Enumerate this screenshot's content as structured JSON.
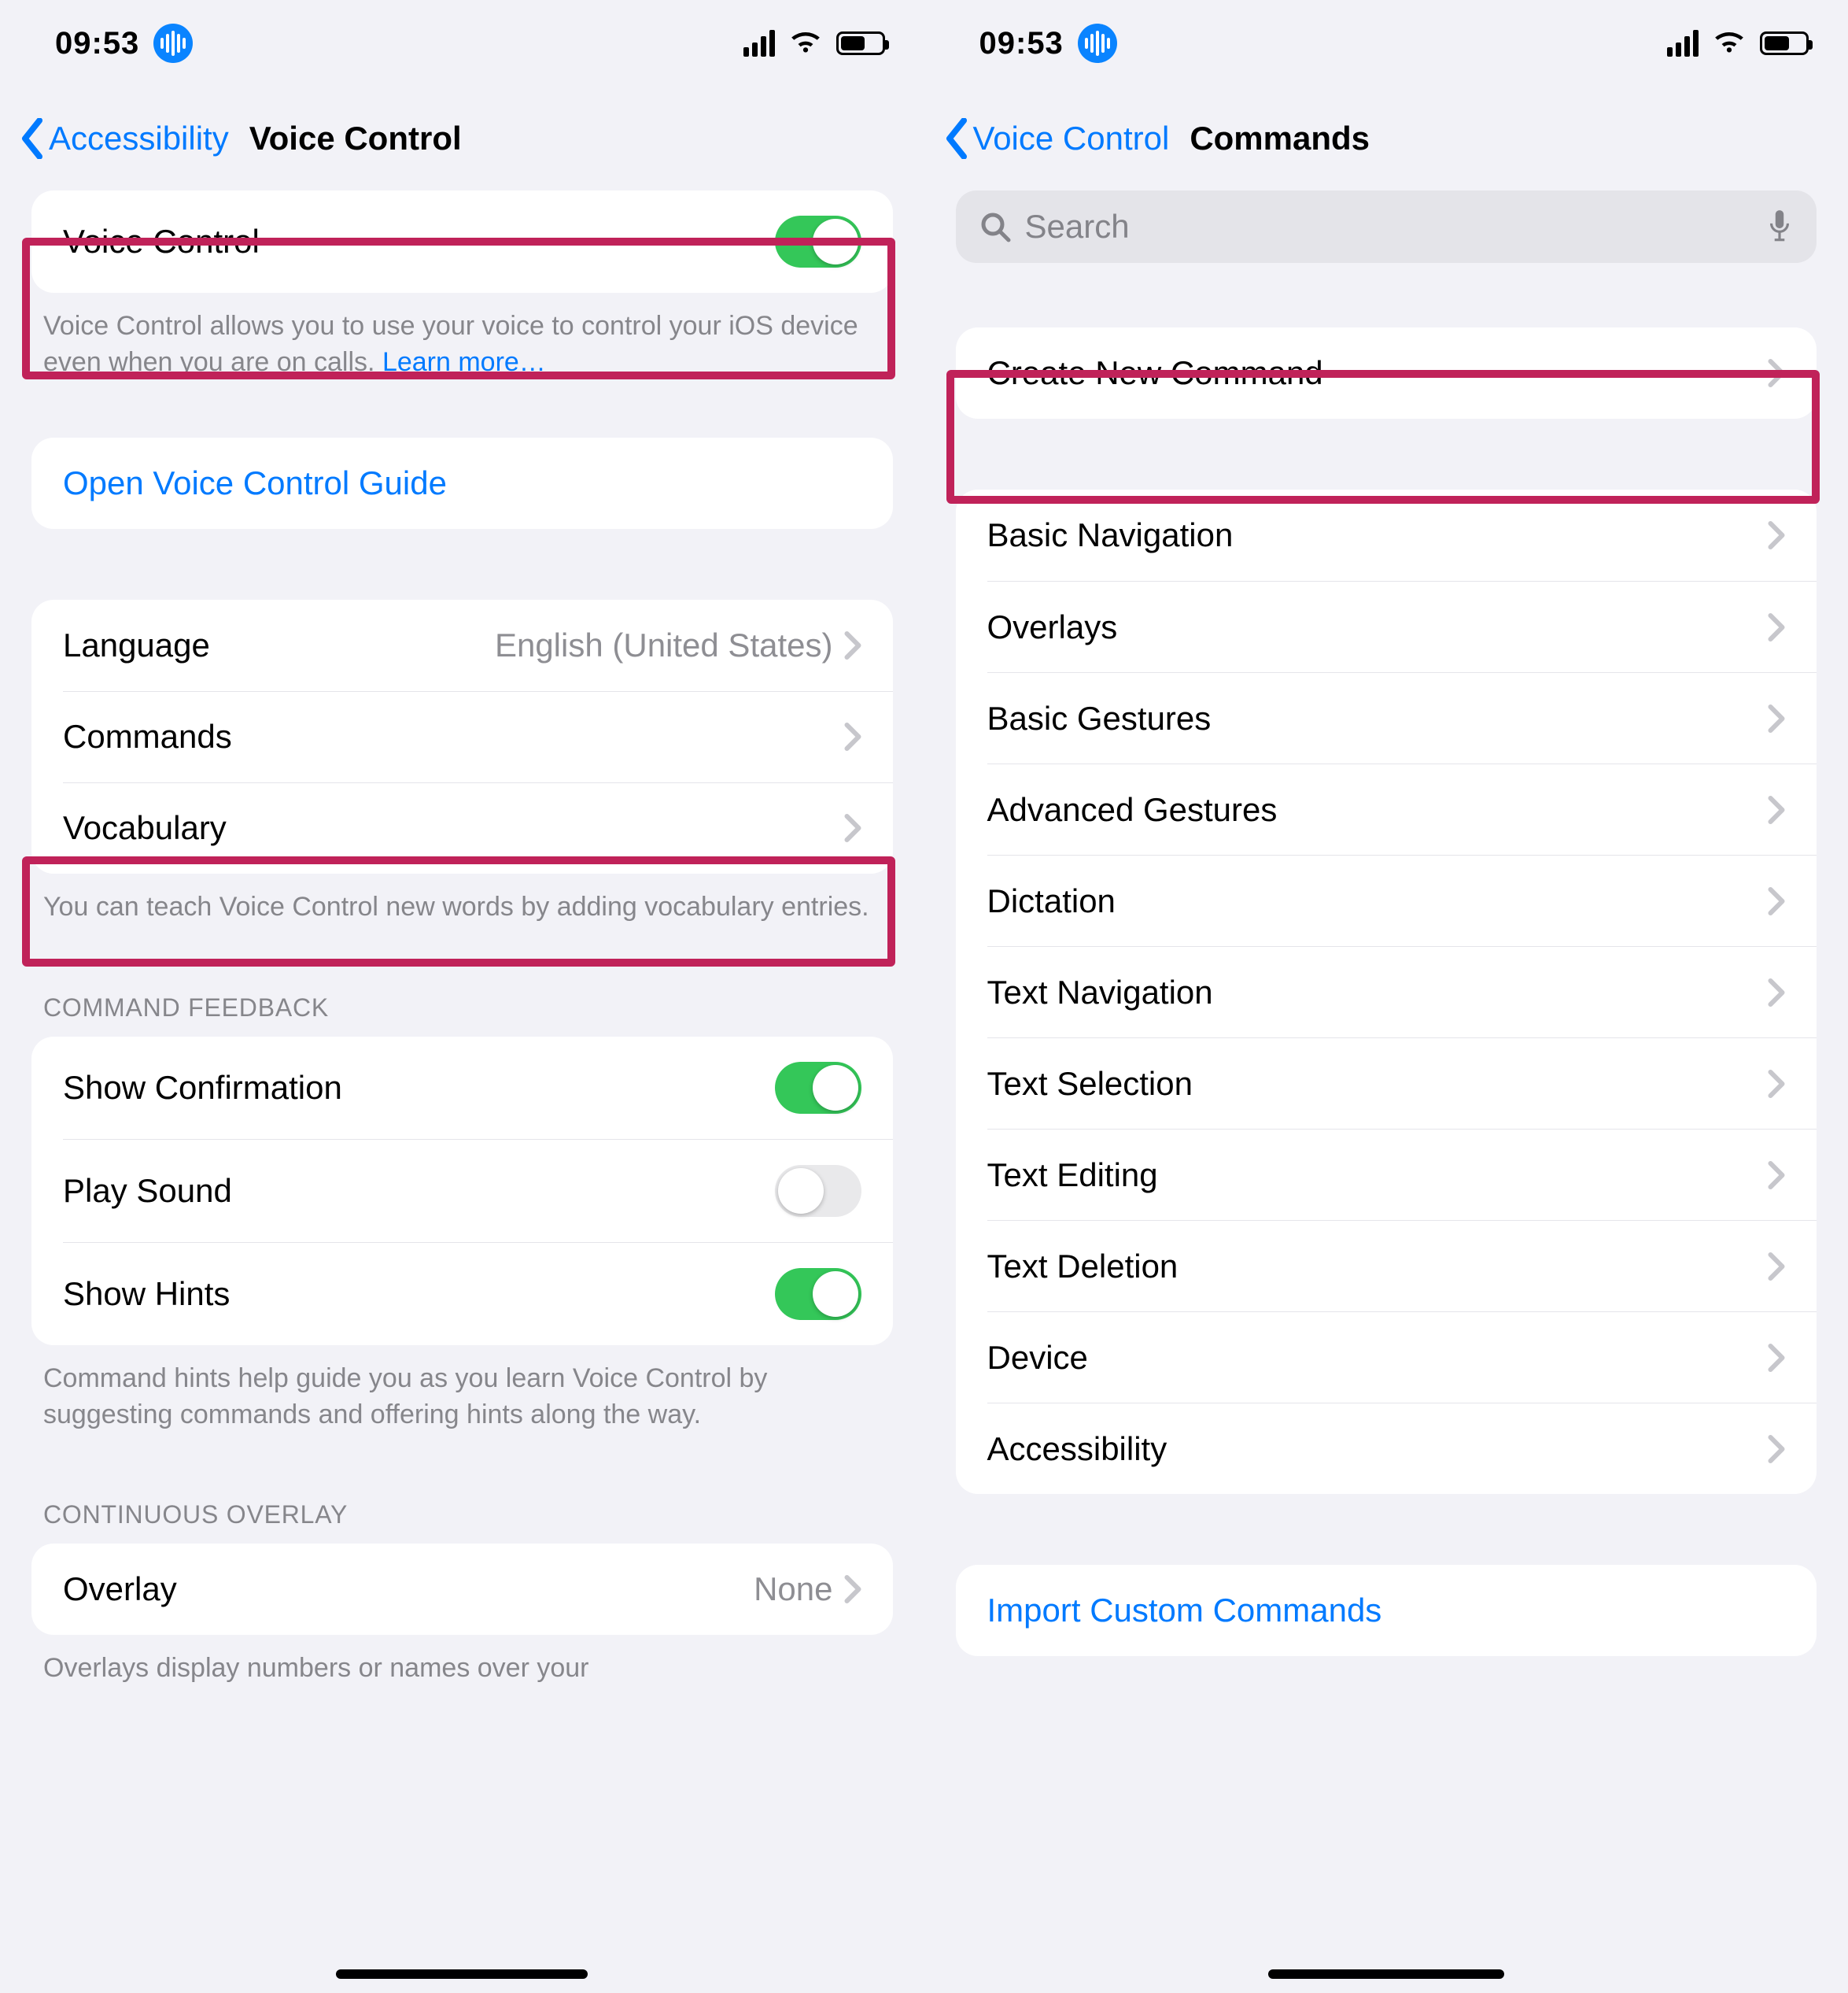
{
  "status": {
    "time": "09:53"
  },
  "left": {
    "nav_back": "Accessibility",
    "nav_title": "Voice Control",
    "main_toggle": {
      "label": "Voice Control",
      "on": true
    },
    "main_desc": "Voice Control allows you to use your voice to control your iOS device even when you are on calls. ",
    "learn_more": "Learn more…",
    "guide_link": "Open Voice Control Guide",
    "lang_row": {
      "label": "Language",
      "value": "English (United States)"
    },
    "commands_row": {
      "label": "Commands"
    },
    "vocab_row": {
      "label": "Vocabulary"
    },
    "vocab_desc": "You can teach Voice Control new words by adding vocabulary entries.",
    "feedback_header": "COMMAND FEEDBACK",
    "feedback": [
      {
        "label": "Show Confirmation",
        "on": true
      },
      {
        "label": "Play Sound",
        "on": false
      },
      {
        "label": "Show Hints",
        "on": true
      }
    ],
    "feedback_desc": "Command hints help guide you as you learn Voice Control by suggesting commands and offering hints along the way.",
    "overlay_header": "CONTINUOUS OVERLAY",
    "overlay_row": {
      "label": "Overlay",
      "value": "None"
    },
    "overlay_desc": "Overlays display numbers or names over your"
  },
  "right": {
    "nav_back": "Voice Control",
    "nav_title": "Commands",
    "search_placeholder": "Search",
    "create_row": "Create New Command",
    "categories": [
      "Basic Navigation",
      "Overlays",
      "Basic Gestures",
      "Advanced Gestures",
      "Dictation",
      "Text Navigation",
      "Text Selection",
      "Text Editing",
      "Text Deletion",
      "Device",
      "Accessibility"
    ],
    "import_link": "Import Custom Commands"
  }
}
